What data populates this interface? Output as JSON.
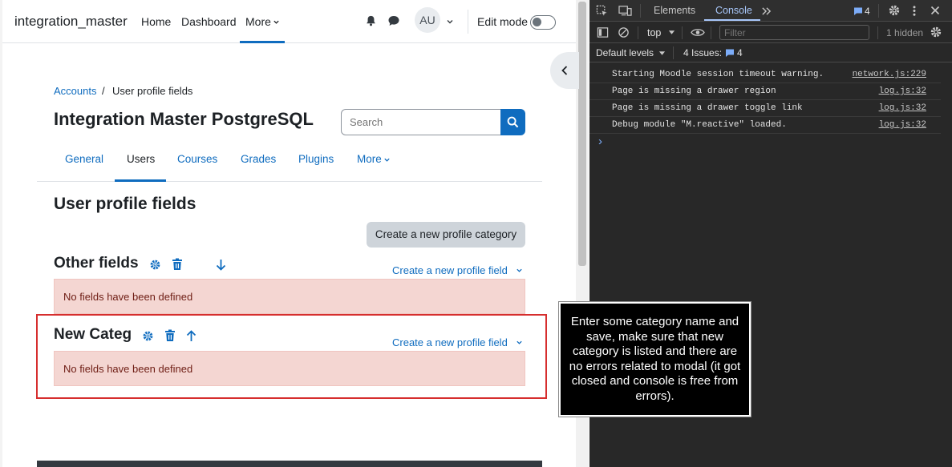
{
  "navbar": {
    "brand": "integration_master",
    "links": [
      "Home",
      "Dashboard",
      "More"
    ],
    "avatar_initials": "AU",
    "edit_mode_label": "Edit mode"
  },
  "breadcrumb": {
    "items": [
      "Accounts",
      "User profile fields"
    ]
  },
  "page_title": "Integration Master PostgreSQL",
  "search": {
    "placeholder": "Search"
  },
  "tabs": [
    "General",
    "Users",
    "Courses",
    "Grades",
    "Plugins",
    "More"
  ],
  "heading": "User profile fields",
  "create_category_label": "Create a new profile category",
  "categories": [
    {
      "name": "Other fields",
      "create_field_label": "Create a new profile field",
      "empty_message": "No fields have been defined"
    },
    {
      "name": "New Categ",
      "create_field_label": "Create a new profile field",
      "empty_message": "No fields have been defined"
    }
  ],
  "annotation": "Enter some category name and save, make sure that new category is listed and there are no errors related to modal (it got closed and console is free from errors).",
  "devtools": {
    "tabs": [
      "Elements",
      "Console"
    ],
    "issues_badge": "4",
    "context": "top",
    "filter_placeholder": "Filter",
    "hidden_count": "1 hidden",
    "levels_label": "Default levels",
    "issues_label": "4 Issues:",
    "issues_count": "4",
    "logs": [
      {
        "message": "Starting Moodle session timeout warning.",
        "source": "network.js:229"
      },
      {
        "message": "Page is missing a drawer region",
        "source": "log.js:32"
      },
      {
        "message": "Page is missing a drawer toggle link",
        "source": "log.js:32"
      },
      {
        "message": "Debug module \"M.reactive\" loaded.",
        "source": "log.js:32"
      }
    ],
    "prompt": "›"
  },
  "colors": {
    "primary": "#0f6cbf",
    "alert_bg": "#f4d6d2",
    "highlight_frame": "#d62e2e",
    "devtools_bg": "#282828"
  }
}
